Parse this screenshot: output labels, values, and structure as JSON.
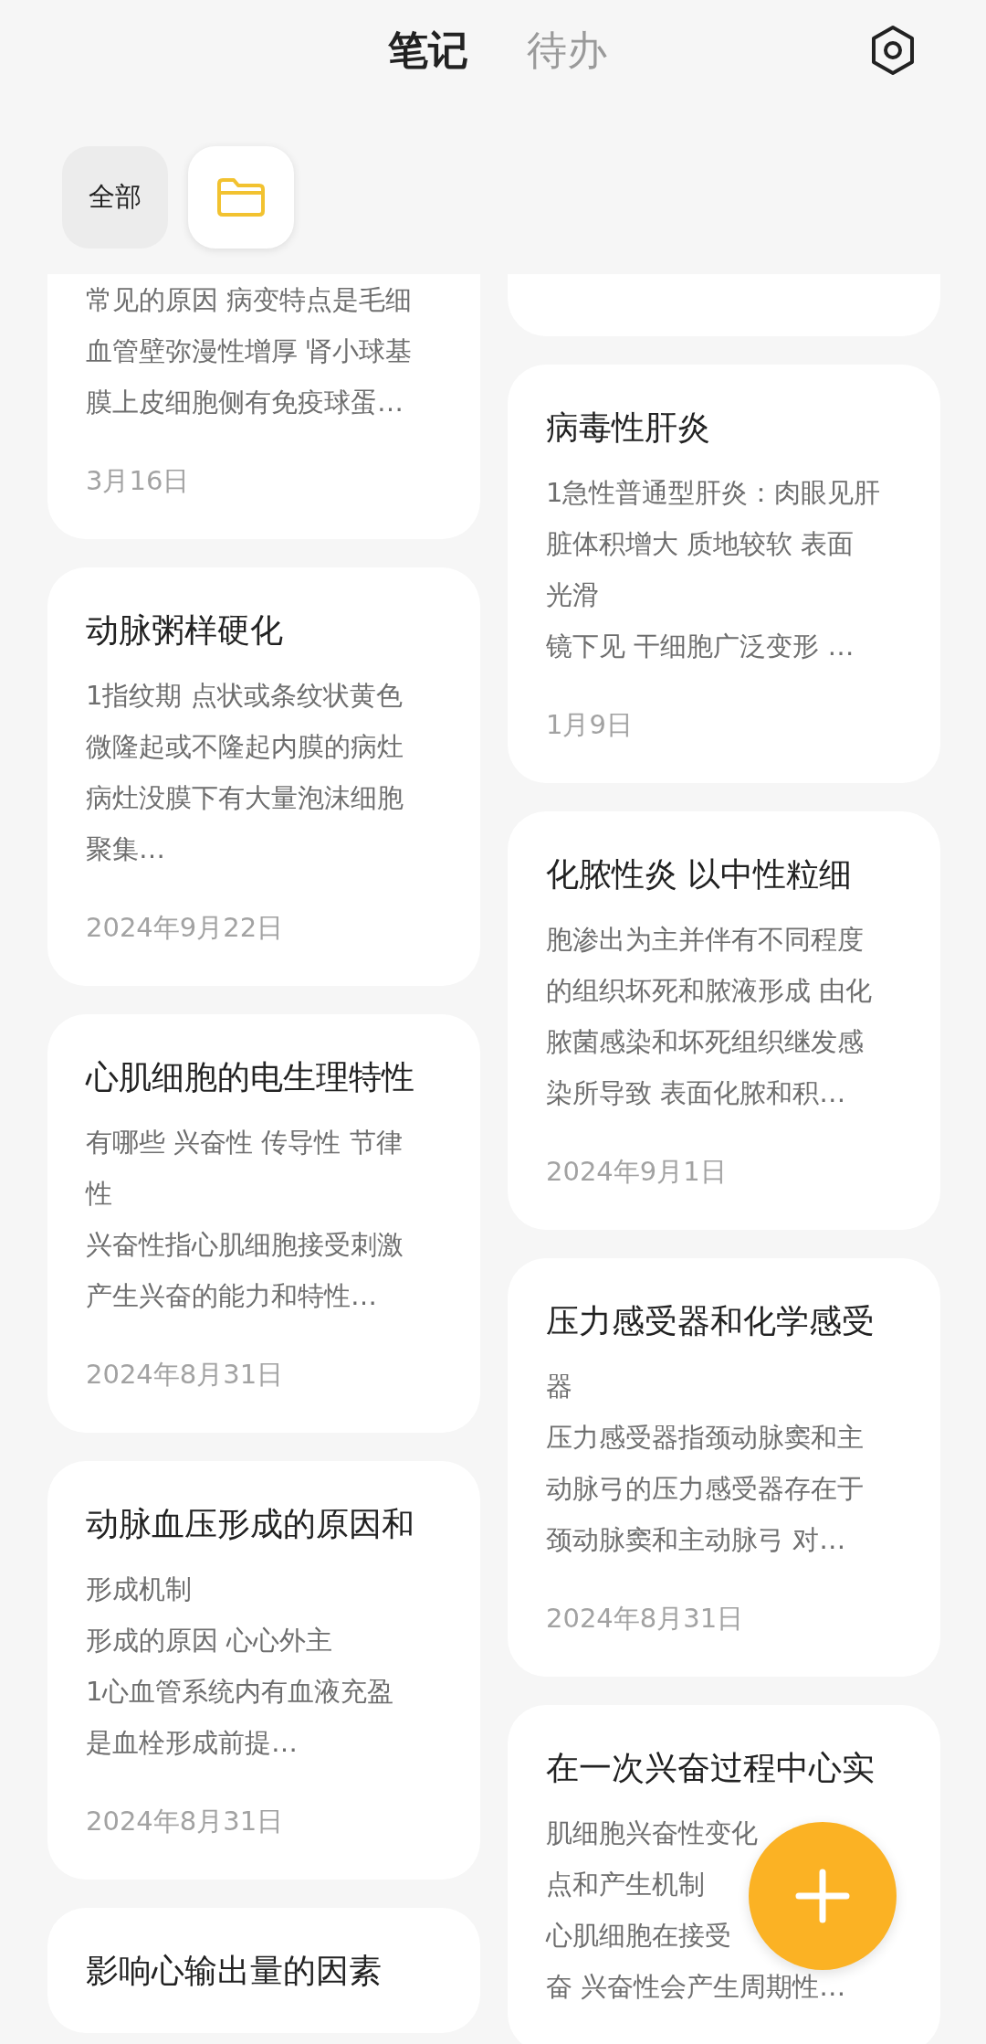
{
  "tabs": [
    {
      "label": "笔记",
      "selected": true
    },
    {
      "label": "待办",
      "selected": false
    }
  ],
  "folders": [
    {
      "kind": "label",
      "label": "全部",
      "selected": false
    },
    {
      "kind": "folder",
      "selected": true
    }
  ],
  "columns": [
    {
      "notes": [
        {
          "kind": "clipped",
          "body": [
            "常见的原因 病变特点是毛细",
            "血管壁弥漫性增厚 肾小球基",
            "膜上皮细胞侧有免疫球蛋…"
          ],
          "date": "3月16日"
        },
        {
          "kind": "full",
          "title": "动脉粥样硬化",
          "body": [
            "1指纹期 点状或条纹状黄色",
            "微隆起或不隆起内膜的病灶",
            "病灶没膜下有大量泡沫细胞",
            "聚集…"
          ],
          "date": "2024年9月22日"
        },
        {
          "kind": "full",
          "title": "心肌细胞的电生理特性",
          "body": [
            "有哪些 兴奋性 传导性 节律",
            "性",
            "兴奋性指心肌细胞接受刺激",
            "产生兴奋的能力和特性…"
          ],
          "date": "2024年8月31日"
        },
        {
          "kind": "full",
          "title": "动脉血压形成的原因和",
          "body": [
            "形成机制",
            "形成的原因 心心外主",
            "1心血管系统内有血液充盈",
            "是血栓形成前提…"
          ],
          "date": "2024年8月31日"
        },
        {
          "kind": "full",
          "title": "影响心输出量的因素"
        }
      ]
    },
    {
      "notes": [
        {
          "kind": "clipped"
        },
        {
          "kind": "full",
          "title": "病毒性肝炎",
          "body": [
            "1急性普通型肝炎：肉眼见肝",
            "脏体积增大 质地较软 表面",
            "光滑",
            "镜下见 干细胞广泛变形 …"
          ],
          "date": "1月9日"
        },
        {
          "kind": "full",
          "title": "化脓性炎 以中性粒细",
          "body": [
            "胞渗出为主并伴有不同程度",
            "的组织坏死和脓液形成 由化",
            "脓菌感染和坏死组织继发感",
            "染所导致 表面化脓和积…"
          ],
          "date": "2024年9月1日"
        },
        {
          "kind": "full",
          "title": "压力感受器和化学感受",
          "body": [
            "器",
            "压力感受器指颈动脉窦和主",
            "动脉弓的压力感受器存在于",
            "颈动脉窦和主动脉弓 对…"
          ],
          "date": "2024年8月31日"
        },
        {
          "kind": "full",
          "title": "在一次兴奋过程中心实",
          "body": [
            "肌细胞兴奋性变化",
            "点和产生机制",
            "心肌细胞在接受",
            "奋 兴奋性会产生周期性…"
          ]
        }
      ]
    }
  ]
}
